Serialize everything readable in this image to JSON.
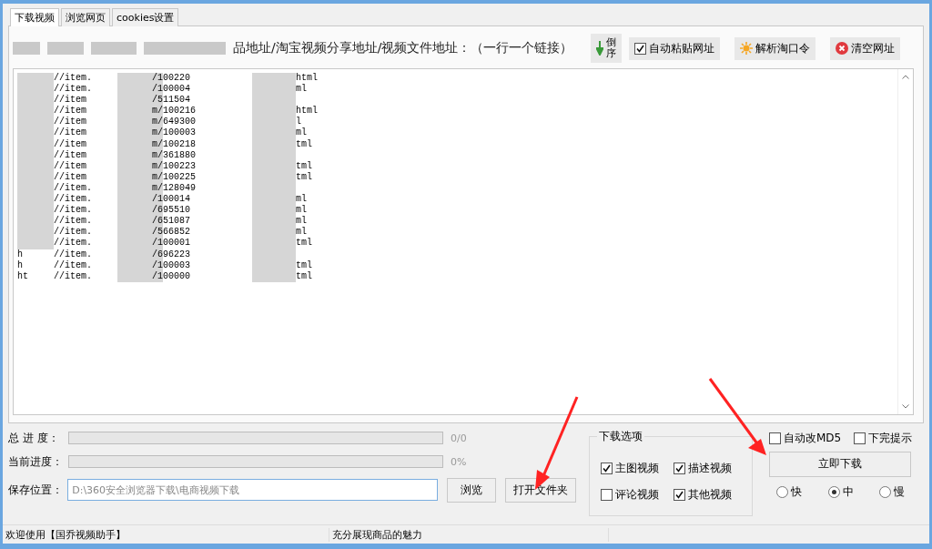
{
  "tabs": [
    {
      "label": "下载视频",
      "selected": true
    },
    {
      "label": "浏览网页",
      "selected": false
    },
    {
      "label": "cookies设置",
      "selected": false
    }
  ],
  "url_prompt": "品地址/淘宝视频分享地址/视频文件地址：（一行一个链接）",
  "toolbar": [
    {
      "kind": "icon_button",
      "label": "倒序"
    },
    {
      "kind": "checkbox",
      "label": "自动粘贴网址",
      "checked": true
    },
    {
      "kind": "button",
      "label": "解析淘口令"
    },
    {
      "kind": "button",
      "label": "清空网址"
    }
  ],
  "url_lines": [
    {
      "host": "//item.",
      "path": "/100220",
      "tail": "html"
    },
    {
      "host": "//item.",
      "path": "/100004",
      "tail": "ml"
    },
    {
      "host": "//item",
      "path": "/511504"
    },
    {
      "host": "//item",
      "path": "m/100216",
      "tail": "html"
    },
    {
      "host": "//item",
      "path": "m/649300",
      "tail": "l"
    },
    {
      "host": "//item",
      "path": "m/100003",
      "tail": "ml"
    },
    {
      "host": "//item",
      "path": "m/100218",
      "tail": "tml"
    },
    {
      "host": "//item",
      "path": "m/361880"
    },
    {
      "host": "//item",
      "path": "m/100223",
      "tail": "tml"
    },
    {
      "host": "//item",
      "path": "m/100225",
      "tail": "tml"
    },
    {
      "host": "//item.",
      "path": "m/128049"
    },
    {
      "host": "//item.",
      "path": "/100014",
      "tail": "ml"
    },
    {
      "host": "//item.",
      "path": "/695510",
      "tail": "ml"
    },
    {
      "host": "//item.",
      "path": "/651087",
      "tail": "ml"
    },
    {
      "host": "//item.",
      "path": "/566852",
      "tail": "ml"
    },
    {
      "host": "//item.",
      "path": "/100001",
      "tail": "tml"
    },
    {
      "prefix": "h",
      "host": "//item.",
      "path": "/696223"
    },
    {
      "prefix": "h",
      "host": "//item.",
      "path": "/100003",
      "tail": "tml"
    },
    {
      "prefix": "ht",
      "host": "//item.",
      "path": "/100000",
      "tail": "tml"
    }
  ],
  "progress": [
    {
      "label": "总 进 度：",
      "level": 0,
      "reading": "0/0"
    },
    {
      "label": "当前进度：",
      "level": 0,
      "reading": "0%"
    }
  ],
  "save_location": {
    "label": "保存位置：",
    "value": "D:\\360安全浏览器下载\\电商视频下载",
    "browse": "浏览",
    "open_folder": "打开文件夹"
  },
  "download_options": {
    "title": "下载选项",
    "items": [
      {
        "label": "主图视频",
        "checked": true
      },
      {
        "label": "描述视频",
        "checked": true
      },
      {
        "label": "评论视频",
        "checked": false
      },
      {
        "label": "其他视频",
        "checked": true
      }
    ]
  },
  "extra_options": [
    {
      "label": "自动改MD5",
      "checked": false
    },
    {
      "label": "下完提示",
      "checked": false
    }
  ],
  "download_button": "立即下载",
  "speed": [
    {
      "label": "快",
      "selected": false
    },
    {
      "label": "中",
      "selected": true
    },
    {
      "label": "慢",
      "selected": false
    }
  ],
  "status_bar": [
    "欢迎使用【国乔视频助手】",
    "充分展现商品的魅力"
  ]
}
